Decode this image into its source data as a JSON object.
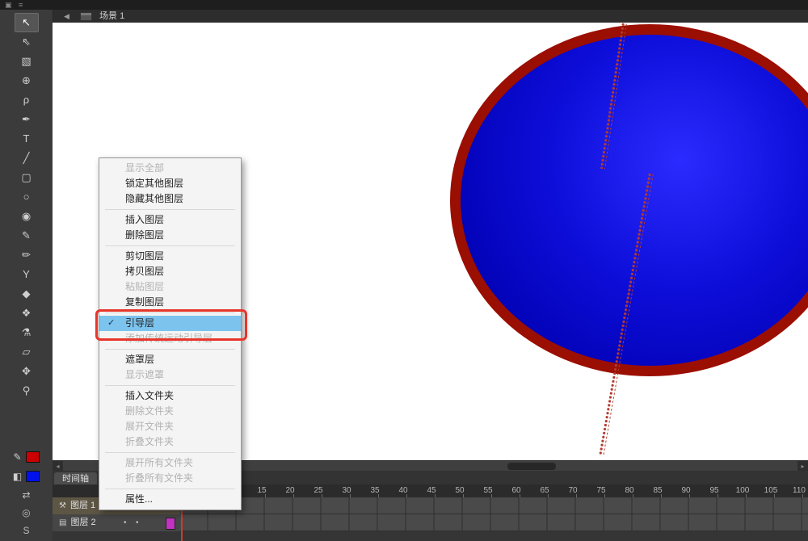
{
  "window": {
    "top_icons": [
      {
        "name": "app-icon",
        "glyph": "▣"
      },
      {
        "name": "menu-icon",
        "glyph": "≡"
      }
    ]
  },
  "edit_bar": {
    "back_icon": "◀",
    "scene_label": "场景 1"
  },
  "toolbar": {
    "tools": [
      {
        "name": "selection",
        "glyph": "↖",
        "selected": true
      },
      {
        "name": "subselection",
        "glyph": "⇖"
      },
      {
        "name": "free-transform",
        "glyph": "▧"
      },
      {
        "name": "3d-rotation",
        "glyph": "⊕"
      },
      {
        "name": "lasso",
        "glyph": "ρ"
      },
      {
        "name": "pen",
        "glyph": "✒"
      },
      {
        "name": "text",
        "glyph": "T"
      },
      {
        "name": "line",
        "glyph": "╱"
      },
      {
        "name": "rectangle",
        "glyph": "▢"
      },
      {
        "name": "oval",
        "glyph": "○"
      },
      {
        "name": "polystar",
        "glyph": "◉"
      },
      {
        "name": "pencil",
        "glyph": "✎"
      },
      {
        "name": "brush",
        "glyph": "✏"
      },
      {
        "name": "bone",
        "glyph": "Υ"
      },
      {
        "name": "paint-bucket",
        "glyph": "◆"
      },
      {
        "name": "deco",
        "glyph": "❖"
      },
      {
        "name": "eyedropper",
        "glyph": "⚗"
      },
      {
        "name": "eraser",
        "glyph": "▱"
      },
      {
        "name": "hand",
        "glyph": "✥"
      },
      {
        "name": "zoom",
        "glyph": "⚲"
      }
    ],
    "stroke_icon": "✎",
    "stroke_color": "#cc0000",
    "fill_icon": "◧",
    "fill_color": "#0011ee",
    "swap_icon": "⇄",
    "snap_icon": "◎",
    "bottom_icon": "S"
  },
  "stage": {
    "circle": {
      "stroke": "#9b0e02",
      "fill_center": "#2b2bff",
      "fill_mid": "#0d0dd8",
      "fill_edge": "#0000b0"
    },
    "guide_color": "#b23b2e"
  },
  "context_menu": {
    "check_icon": "✓",
    "items": [
      {
        "label": "显示全部",
        "state": "disabled"
      },
      {
        "label": "锁定其他图层",
        "state": "normal"
      },
      {
        "label": "隐藏其他图层",
        "state": "normal"
      },
      {
        "divider": true
      },
      {
        "label": "插入图层",
        "state": "normal"
      },
      {
        "label": "删除图层",
        "state": "normal"
      },
      {
        "divider": true
      },
      {
        "label": "剪切图层",
        "state": "normal"
      },
      {
        "label": "拷贝图层",
        "state": "normal"
      },
      {
        "label": "粘贴图层",
        "state": "disabled"
      },
      {
        "label": "复制图层",
        "state": "normal"
      },
      {
        "divider": true
      },
      {
        "label": "引导层",
        "state": "checked"
      },
      {
        "label": "添加传统运动引导层",
        "state": "disabled"
      },
      {
        "divider": true
      },
      {
        "label": "遮罩层",
        "state": "normal"
      },
      {
        "label": "显示遮罩",
        "state": "disabled"
      },
      {
        "divider": true
      },
      {
        "label": "插入文件夹",
        "state": "normal"
      },
      {
        "label": "删除文件夹",
        "state": "disabled"
      },
      {
        "label": "展开文件夹",
        "state": "disabled"
      },
      {
        "label": "折叠文件夹",
        "state": "disabled"
      },
      {
        "divider": true
      },
      {
        "label": "展开所有文件夹",
        "state": "disabled"
      },
      {
        "label": "折叠所有文件夹",
        "state": "disabled"
      },
      {
        "divider": true
      },
      {
        "label": "属性...",
        "state": "normal"
      }
    ]
  },
  "annotation": {
    "color": "#e8352a"
  },
  "timeline": {
    "tab_label": "时间轴",
    "frame_numbers": [
      15,
      20,
      25,
      30,
      35,
      40,
      45,
      50,
      55,
      60,
      65,
      70,
      75,
      80,
      85,
      90,
      95,
      100,
      105,
      110
    ],
    "playhead_frame": 1,
    "playhead_color": "#d03a30",
    "layers": [
      {
        "name": "图层 1",
        "icon": "⚒",
        "selected": true,
        "editing_icon": "✎",
        "dots": [
          "•",
          "•"
        ]
      },
      {
        "name": "图层 2",
        "icon": "▤",
        "selected": false,
        "dots": [
          "•",
          "•"
        ],
        "outline_color": "#c233c2"
      }
    ]
  },
  "scrollbar": {
    "left_arrow": "◂",
    "right_arrow": "▸"
  }
}
